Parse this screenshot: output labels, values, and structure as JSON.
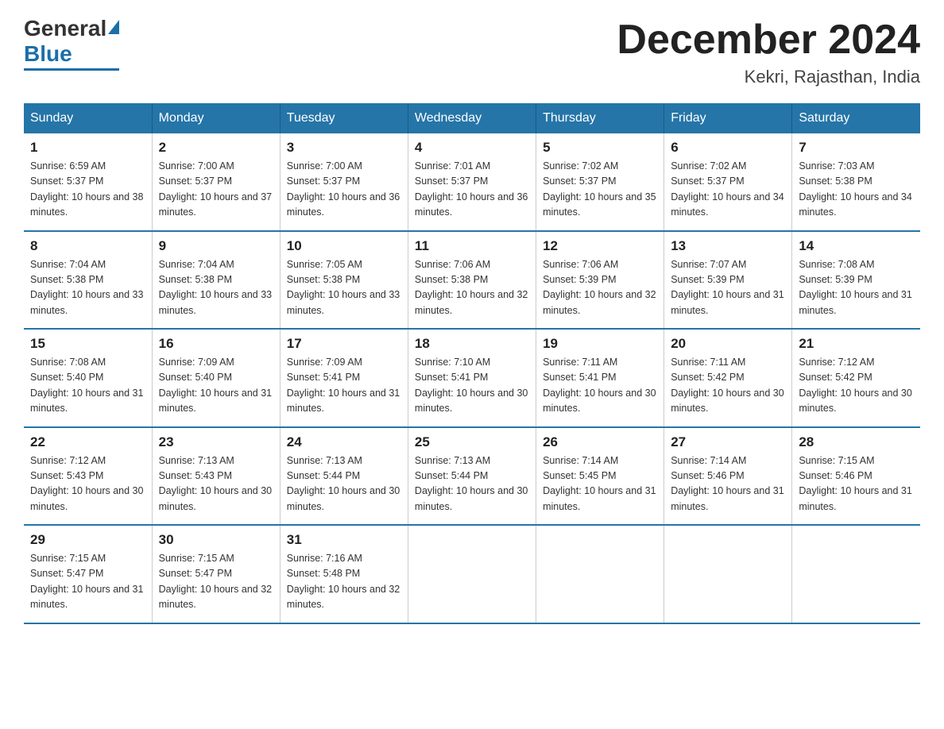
{
  "header": {
    "logo_general": "General",
    "logo_blue": "Blue",
    "month_title": "December 2024",
    "location": "Kekri, Rajasthan, India"
  },
  "days_of_week": [
    "Sunday",
    "Monday",
    "Tuesday",
    "Wednesday",
    "Thursday",
    "Friday",
    "Saturday"
  ],
  "weeks": [
    [
      {
        "num": "1",
        "sunrise": "6:59 AM",
        "sunset": "5:37 PM",
        "daylight": "10 hours and 38 minutes."
      },
      {
        "num": "2",
        "sunrise": "7:00 AM",
        "sunset": "5:37 PM",
        "daylight": "10 hours and 37 minutes."
      },
      {
        "num": "3",
        "sunrise": "7:00 AM",
        "sunset": "5:37 PM",
        "daylight": "10 hours and 36 minutes."
      },
      {
        "num": "4",
        "sunrise": "7:01 AM",
        "sunset": "5:37 PM",
        "daylight": "10 hours and 36 minutes."
      },
      {
        "num": "5",
        "sunrise": "7:02 AM",
        "sunset": "5:37 PM",
        "daylight": "10 hours and 35 minutes."
      },
      {
        "num": "6",
        "sunrise": "7:02 AM",
        "sunset": "5:37 PM",
        "daylight": "10 hours and 34 minutes."
      },
      {
        "num": "7",
        "sunrise": "7:03 AM",
        "sunset": "5:38 PM",
        "daylight": "10 hours and 34 minutes."
      }
    ],
    [
      {
        "num": "8",
        "sunrise": "7:04 AM",
        "sunset": "5:38 PM",
        "daylight": "10 hours and 33 minutes."
      },
      {
        "num": "9",
        "sunrise": "7:04 AM",
        "sunset": "5:38 PM",
        "daylight": "10 hours and 33 minutes."
      },
      {
        "num": "10",
        "sunrise": "7:05 AM",
        "sunset": "5:38 PM",
        "daylight": "10 hours and 33 minutes."
      },
      {
        "num": "11",
        "sunrise": "7:06 AM",
        "sunset": "5:38 PM",
        "daylight": "10 hours and 32 minutes."
      },
      {
        "num": "12",
        "sunrise": "7:06 AM",
        "sunset": "5:39 PM",
        "daylight": "10 hours and 32 minutes."
      },
      {
        "num": "13",
        "sunrise": "7:07 AM",
        "sunset": "5:39 PM",
        "daylight": "10 hours and 31 minutes."
      },
      {
        "num": "14",
        "sunrise": "7:08 AM",
        "sunset": "5:39 PM",
        "daylight": "10 hours and 31 minutes."
      }
    ],
    [
      {
        "num": "15",
        "sunrise": "7:08 AM",
        "sunset": "5:40 PM",
        "daylight": "10 hours and 31 minutes."
      },
      {
        "num": "16",
        "sunrise": "7:09 AM",
        "sunset": "5:40 PM",
        "daylight": "10 hours and 31 minutes."
      },
      {
        "num": "17",
        "sunrise": "7:09 AM",
        "sunset": "5:41 PM",
        "daylight": "10 hours and 31 minutes."
      },
      {
        "num": "18",
        "sunrise": "7:10 AM",
        "sunset": "5:41 PM",
        "daylight": "10 hours and 30 minutes."
      },
      {
        "num": "19",
        "sunrise": "7:11 AM",
        "sunset": "5:41 PM",
        "daylight": "10 hours and 30 minutes."
      },
      {
        "num": "20",
        "sunrise": "7:11 AM",
        "sunset": "5:42 PM",
        "daylight": "10 hours and 30 minutes."
      },
      {
        "num": "21",
        "sunrise": "7:12 AM",
        "sunset": "5:42 PM",
        "daylight": "10 hours and 30 minutes."
      }
    ],
    [
      {
        "num": "22",
        "sunrise": "7:12 AM",
        "sunset": "5:43 PM",
        "daylight": "10 hours and 30 minutes."
      },
      {
        "num": "23",
        "sunrise": "7:13 AM",
        "sunset": "5:43 PM",
        "daylight": "10 hours and 30 minutes."
      },
      {
        "num": "24",
        "sunrise": "7:13 AM",
        "sunset": "5:44 PM",
        "daylight": "10 hours and 30 minutes."
      },
      {
        "num": "25",
        "sunrise": "7:13 AM",
        "sunset": "5:44 PM",
        "daylight": "10 hours and 30 minutes."
      },
      {
        "num": "26",
        "sunrise": "7:14 AM",
        "sunset": "5:45 PM",
        "daylight": "10 hours and 31 minutes."
      },
      {
        "num": "27",
        "sunrise": "7:14 AM",
        "sunset": "5:46 PM",
        "daylight": "10 hours and 31 minutes."
      },
      {
        "num": "28",
        "sunrise": "7:15 AM",
        "sunset": "5:46 PM",
        "daylight": "10 hours and 31 minutes."
      }
    ],
    [
      {
        "num": "29",
        "sunrise": "7:15 AM",
        "sunset": "5:47 PM",
        "daylight": "10 hours and 31 minutes."
      },
      {
        "num": "30",
        "sunrise": "7:15 AM",
        "sunset": "5:47 PM",
        "daylight": "10 hours and 32 minutes."
      },
      {
        "num": "31",
        "sunrise": "7:16 AM",
        "sunset": "5:48 PM",
        "daylight": "10 hours and 32 minutes."
      },
      null,
      null,
      null,
      null
    ]
  ]
}
